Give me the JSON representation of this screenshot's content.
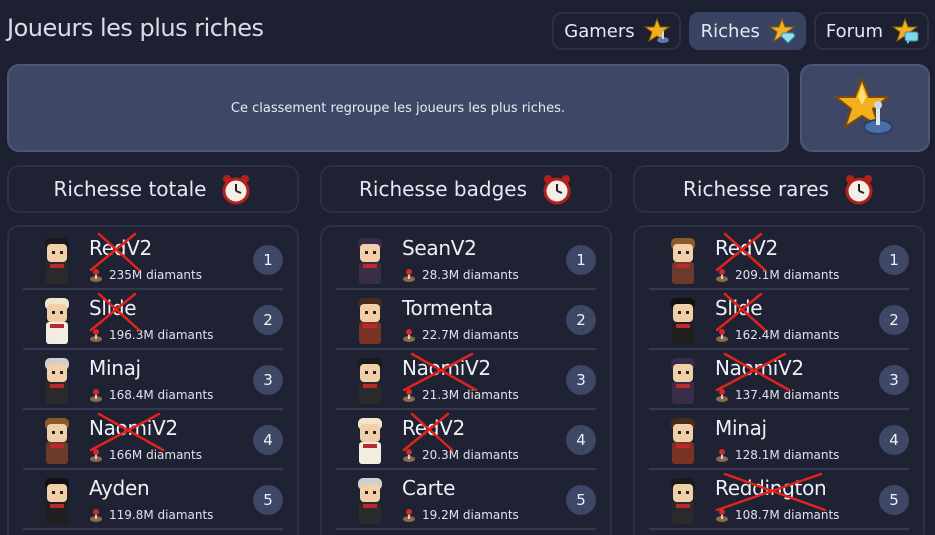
{
  "page": {
    "title": "Joueurs les plus riches"
  },
  "tabs": [
    {
      "label": "Gamers",
      "icon": "star-joystick-icon",
      "active": false
    },
    {
      "label": "Riches",
      "icon": "star-diamond-icon",
      "active": true
    },
    {
      "label": "Forum",
      "icon": "star-chat-icon",
      "active": false
    }
  ],
  "info": {
    "text": "Ce classement regroupe les joueurs les plus riches.",
    "icon": "star-joystick-icon"
  },
  "columns": [
    {
      "title": "Richesse totale",
      "icon": "alarm-clock-icon",
      "rows": [
        {
          "name": "RedV2",
          "amount": "235M diamants",
          "rank": "1",
          "crossed": true
        },
        {
          "name": "Slide",
          "amount": "196.3M diamants",
          "rank": "2",
          "crossed": true
        },
        {
          "name": "Minaj",
          "amount": "168.4M diamants",
          "rank": "3",
          "crossed": false
        },
        {
          "name": "NaomiV2",
          "amount": "166M diamants",
          "rank": "4",
          "crossed": true
        },
        {
          "name": "Ayden",
          "amount": "119.8M diamants",
          "rank": "5",
          "crossed": false
        }
      ]
    },
    {
      "title": "Richesse badges",
      "icon": "alarm-clock-icon",
      "rows": [
        {
          "name": "SeanV2",
          "amount": "28.3M diamants",
          "rank": "1",
          "crossed": false
        },
        {
          "name": "Tormenta",
          "amount": "22.7M diamants",
          "rank": "2",
          "crossed": false
        },
        {
          "name": "NaomiV2",
          "amount": "21.3M diamants",
          "rank": "3",
          "crossed": true
        },
        {
          "name": "RedV2",
          "amount": "20.3M diamants",
          "rank": "4",
          "crossed": true
        },
        {
          "name": "Carte",
          "amount": "19.2M diamants",
          "rank": "5",
          "crossed": false
        }
      ]
    },
    {
      "title": "Richesse rares",
      "icon": "alarm-clock-icon",
      "rows": [
        {
          "name": "RedV2",
          "amount": "209.1M diamants",
          "rank": "1",
          "crossed": true
        },
        {
          "name": "Slide",
          "amount": "162.4M diamants",
          "rank": "2",
          "crossed": true
        },
        {
          "name": "NaomiV2",
          "amount": "137.4M diamants",
          "rank": "3",
          "crossed": true
        },
        {
          "name": "Minaj",
          "amount": "128.1M diamants",
          "rank": "4",
          "crossed": false
        },
        {
          "name": "Reddington",
          "amount": "108.7M diamants",
          "rank": "5",
          "crossed": true
        }
      ]
    }
  ],
  "colors": {
    "background": "#1c2030",
    "panel": "#3e4765",
    "cross": "#e0241b",
    "accent": "#f2b01e"
  }
}
